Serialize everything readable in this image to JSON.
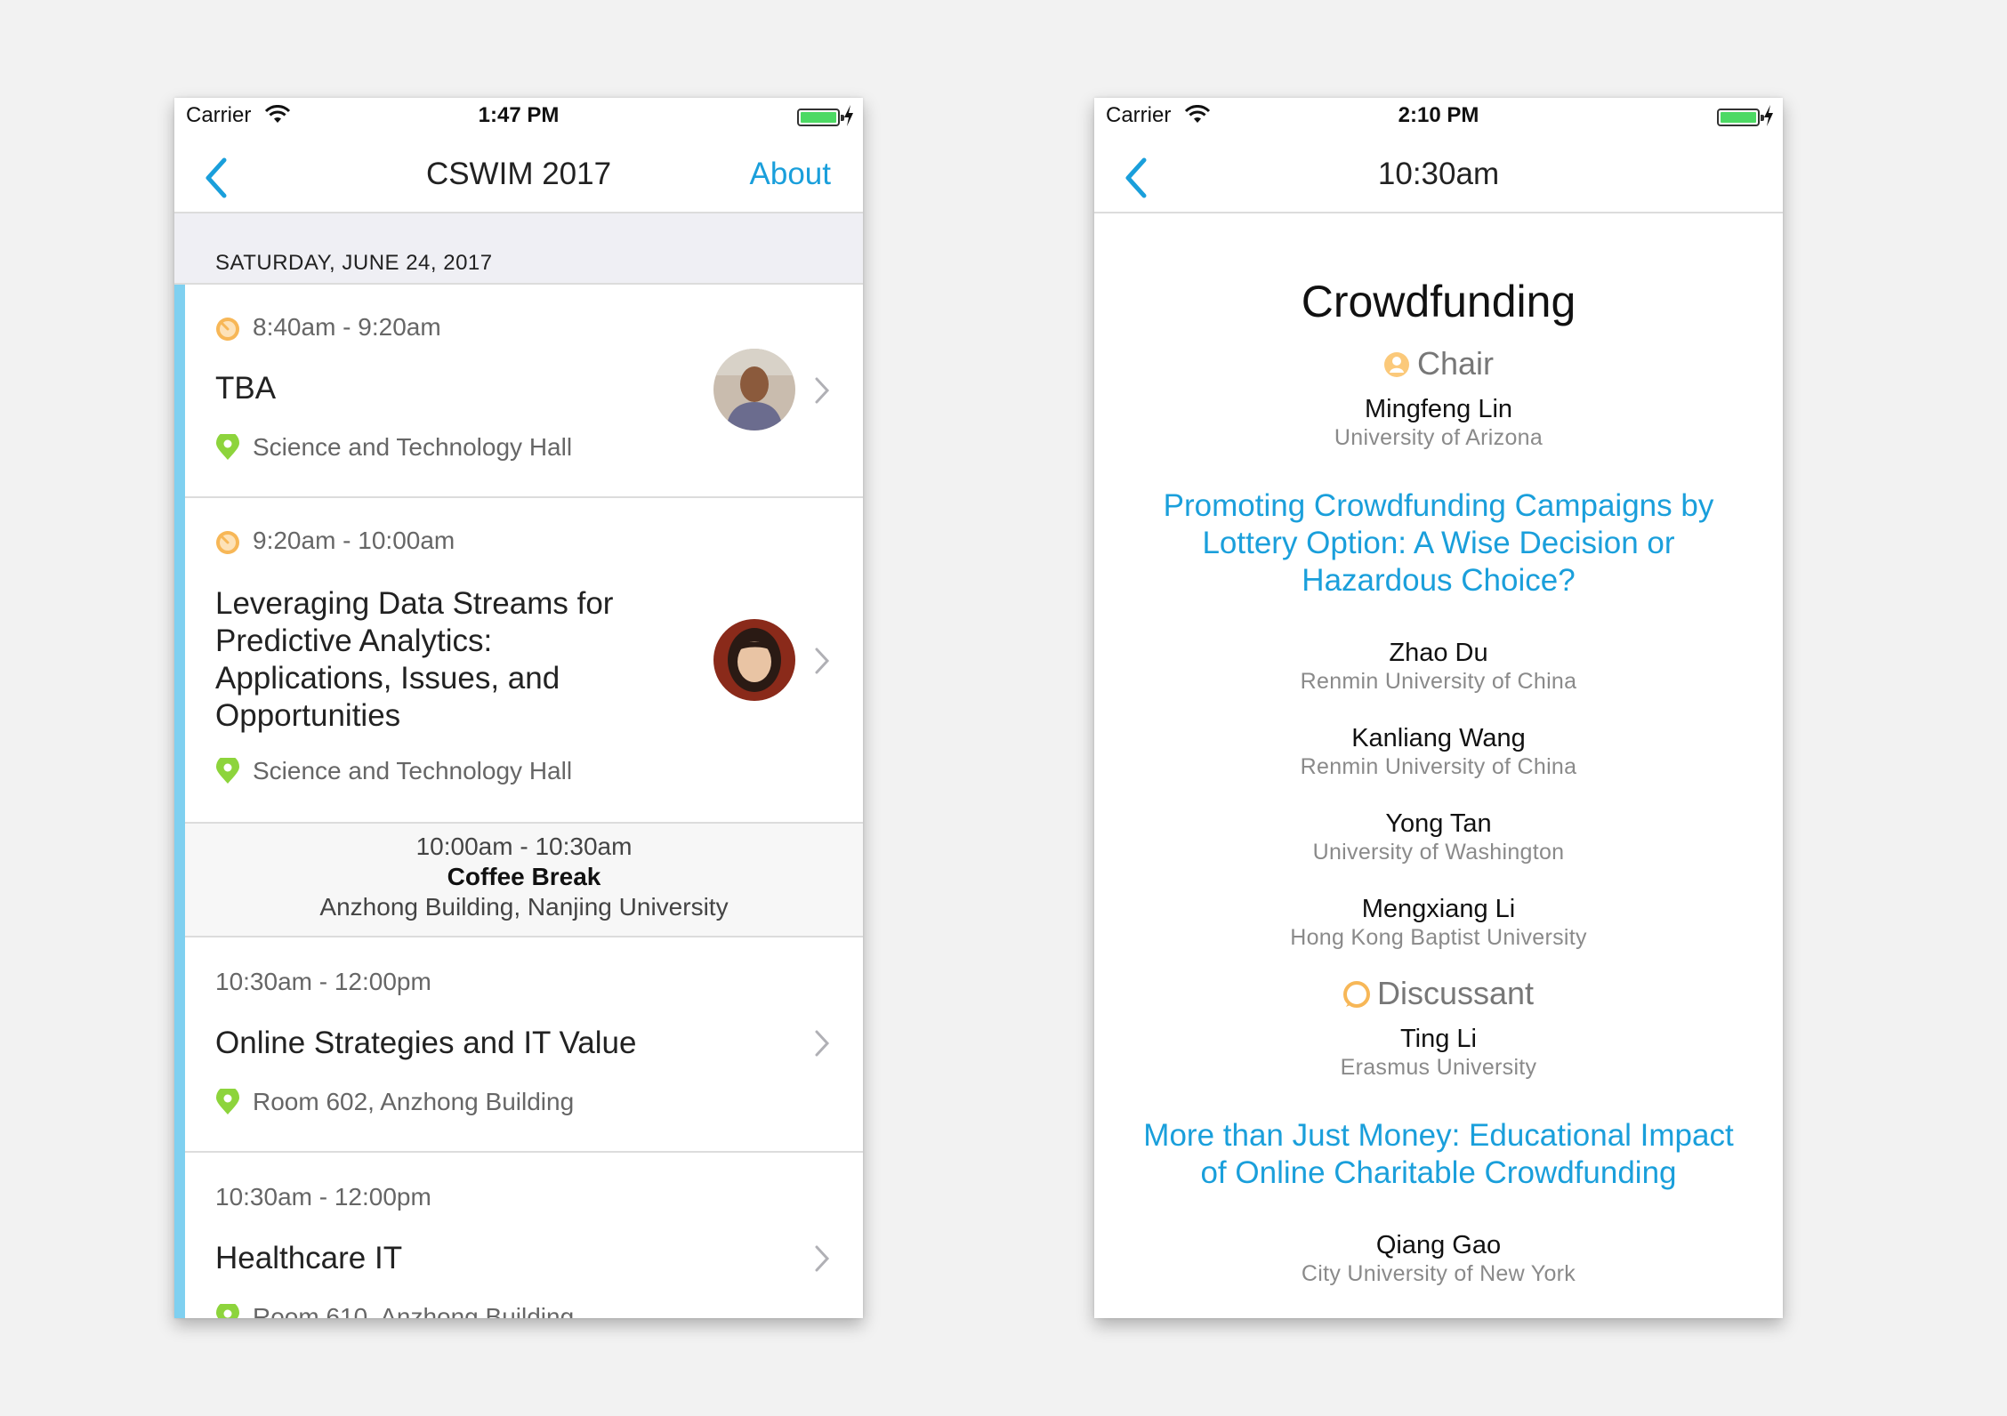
{
  "left": {
    "status": {
      "carrier": "Carrier",
      "time": "1:47 PM"
    },
    "nav": {
      "title": "CSWIM 2017",
      "about": "About"
    },
    "date_header": "SATURDAY, JUNE 24, 2017",
    "sessions": [
      {
        "time": "8:40am - 9:20am",
        "title": "TBA",
        "location": "Science and Technology Hall"
      },
      {
        "time": "9:20am - 10:00am",
        "title": "Leveraging Data Streams for Predictive Analytics: Applications, Issues, and Opportunities",
        "location": "Science and Technology Hall"
      },
      {
        "time": "10:30am - 12:00pm",
        "title": "Online Strategies and IT Value",
        "location": "Room 602, Anzhong Building"
      },
      {
        "time": "10:30am - 12:00pm",
        "title": "Healthcare IT",
        "location": "Room 610, Anzhong Building"
      }
    ],
    "break": {
      "time": "10:00am - 10:30am",
      "title": "Coffee Break",
      "location": "Anzhong Building, Nanjing University"
    }
  },
  "right": {
    "status": {
      "carrier": "Carrier",
      "time": "2:10 PM"
    },
    "nav": {
      "title": "10:30am"
    },
    "session_title": "Crowdfunding",
    "chair": {
      "role": "Chair",
      "name": "Mingfeng Lin",
      "affiliation": "University of Arizona"
    },
    "papers": [
      {
        "title": "Promoting Crowdfunding Campaigns by Lottery Option:  A Wise Decision or Hazardous Choice?",
        "authors": [
          {
            "name": "Zhao Du",
            "affiliation": "Renmin University of China"
          },
          {
            "name": "Kanliang Wang",
            "affiliation": "Renmin University of China"
          },
          {
            "name": "Yong Tan",
            "affiliation": "University of Washington"
          },
          {
            "name": "Mengxiang Li",
            "affiliation": "Hong Kong Baptist University"
          }
        ],
        "discussant": {
          "role": "Discussant",
          "name": "Ting Li",
          "affiliation": "Erasmus University"
        }
      },
      {
        "title": "More than Just Money: Educational Impact of Online Charitable Crowdfunding",
        "authors": [
          {
            "name": "Qiang Gao",
            "affiliation": "City University of New York"
          }
        ]
      }
    ]
  },
  "colors": {
    "accent": "#1a9fdb",
    "accent_bar": "#7fd0f0",
    "location_icon": "#8dd43c",
    "time_icon": "#f7b757"
  },
  "icons": [
    "wifi-icon",
    "battery-icon",
    "back-chevron-icon",
    "clock-icon",
    "location-pin-icon",
    "chevron-right-icon",
    "chair-icon",
    "discussant-icon"
  ]
}
